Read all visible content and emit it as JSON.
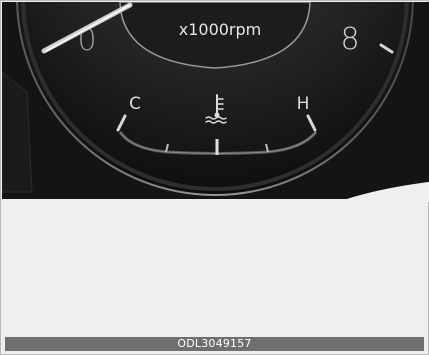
{
  "tachometer": {
    "unit_label": "x1000rpm",
    "visible_numerals": [
      "0",
      "8"
    ]
  },
  "temperature_gauge": {
    "cold_label": "C",
    "hot_label": "H",
    "icon": "coolant-temperature-icon"
  },
  "footer": {
    "image_code": "ODL3049157"
  },
  "colors": {
    "background": "#141414",
    "gauge_light": "#d7d7d7",
    "footer_bar": "#6f6f6f",
    "panel": "#efefef"
  }
}
